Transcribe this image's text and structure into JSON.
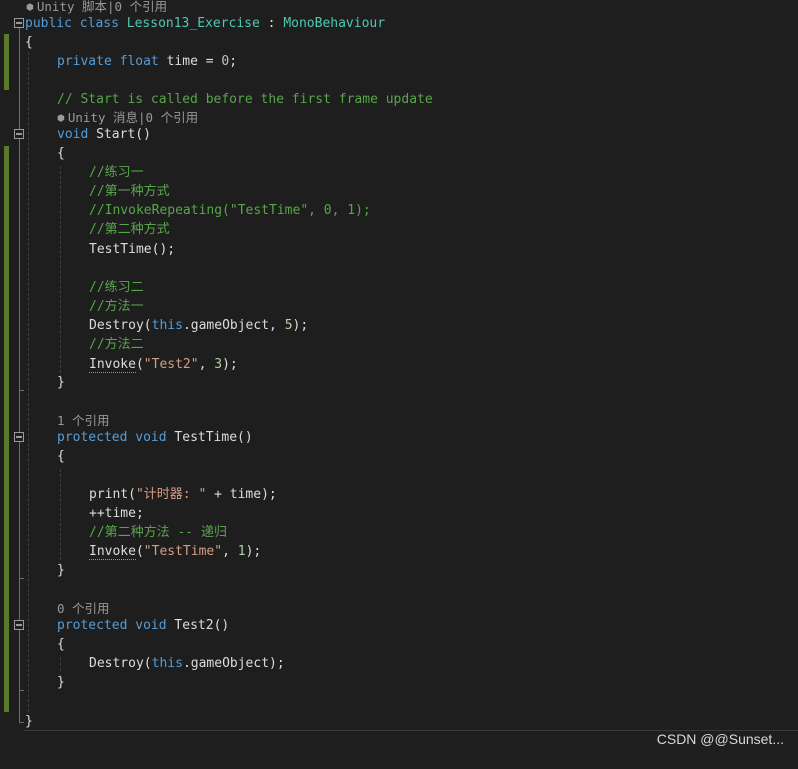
{
  "editor": {
    "class_hint": "Unity 脚本|0 个引用",
    "class_decl": {
      "kw_public": "public",
      "kw_class": "class",
      "class_name": "Lesson13_Exercise",
      "colon": " : ",
      "base_class": "MonoBehaviour"
    },
    "open_brace": "{",
    "field": {
      "kw_private": "private",
      "kw_float": "float",
      "name": "time",
      "assign": " = ",
      "value": "0",
      "end": ";"
    },
    "start_comment": "// Start is called before the first frame update",
    "start_hint": "Unity 消息|0 个引用",
    "start_decl": {
      "kw_void": "void",
      "name": "Start",
      "parens": "()"
    },
    "start_body": {
      "c1": "//练习一",
      "c2": "//第一种方式",
      "c3": "//InvokeRepeating(\"TestTime\", 0, 1);",
      "c4": "//第二种方式",
      "call_testtime": "TestTime();",
      "c5": "//练习二",
      "c6": "//方法一",
      "destroy_fn": "Destroy",
      "destroy_open": "(",
      "kw_this": "this",
      "destroy_arg": ".gameObject, ",
      "destroy_num": "5",
      "destroy_close": ");",
      "c7": "//方法二",
      "invoke_fn": "Invoke",
      "invoke_open": "(",
      "invoke_str": "\"Test2\"",
      "invoke_comma": ", ",
      "invoke_num": "3",
      "invoke_close": ");"
    },
    "testtime_hint": "1 个引用",
    "testtime_decl": {
      "kw_protected": "protected",
      "kw_void": "void",
      "name": "TestTime",
      "parens": "()"
    },
    "testtime_body": {
      "print_fn": "print",
      "print_open": "(",
      "print_str": "\"计时器: \"",
      "print_plus": " + time);",
      "incr": "++time;",
      "c1": "//第二种方法 -- 递归",
      "invoke_fn": "Invoke",
      "invoke_open": "(",
      "invoke_str": "\"TestTime\"",
      "invoke_comma": ", ",
      "invoke_num": "1",
      "invoke_close": ");"
    },
    "test2_hint": "0 个引用",
    "test2_decl": {
      "kw_protected": "protected",
      "kw_void": "void",
      "name": "Test2",
      "parens": "()"
    },
    "test2_body": {
      "destroy_fn": "Destroy",
      "destroy_open": "(",
      "kw_this": "this",
      "destroy_rest": ".gameObject);"
    },
    "close_brace": "}"
  },
  "watermark": "CSDN @@Sunset...",
  "colors": {
    "background": "#1e1e1e",
    "keyword": "#569cd6",
    "type": "#4ec9b0",
    "comment": "#57a64a",
    "string": "#d69d85",
    "number": "#b5cea8",
    "identifier": "#dcdcdc",
    "hint": "#999999",
    "change_bar": "#5b7a2b"
  },
  "icons": [
    "unity-cube-icon",
    "fold-collapse-icon"
  ]
}
